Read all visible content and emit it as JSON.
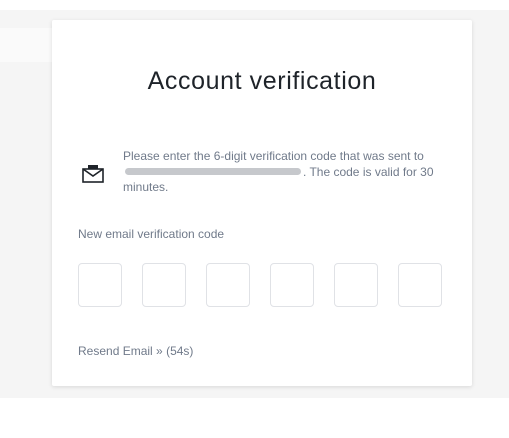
{
  "title": "Account verification",
  "info": {
    "icon": "envelope-icon",
    "text_before": "Please enter the 6-digit verification code that was sent to",
    "text_after": ". The code is valid for 30 minutes."
  },
  "code_field": {
    "label": "New email verification code",
    "digits": [
      "",
      "",
      "",
      "",
      "",
      ""
    ]
  },
  "resend": {
    "label": "Resend Email",
    "chevron": "»",
    "countdown": "(54s)"
  },
  "colors": {
    "text_primary": "#1e2329",
    "text_secondary": "#707a8a",
    "input_border": "#e0e2e6",
    "background": "#f5f5f5"
  }
}
